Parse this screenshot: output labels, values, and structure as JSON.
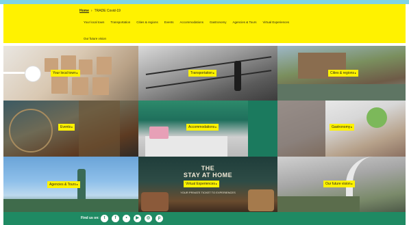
{
  "breadcrumb": {
    "home": "Home",
    "separator": "›",
    "current": "TRADE Covid-19"
  },
  "nav": {
    "row1": [
      "Your local town",
      "Transportation",
      "Cities & regions",
      "Events",
      "Accommodations",
      "Gastronomy",
      "Agencies & Tours",
      "Virtual Experiences"
    ],
    "row2": [
      "Our future vision"
    ]
  },
  "tiles": [
    {
      "label": "Your local town",
      "arrow": "▸"
    },
    {
      "label": "Transportation",
      "arrow": "▸"
    },
    {
      "label": "Cities & regions",
      "arrow": "▸"
    },
    {
      "label": "Events",
      "arrow": "▸"
    },
    {
      "label": "Accommodations",
      "arrow": "▸"
    },
    {
      "label": "Gastronomy",
      "arrow": "▸"
    },
    {
      "label": "Agencies & Tours",
      "arrow": "▸"
    },
    {
      "label": "Virtual Experiences",
      "arrow": "▸"
    },
    {
      "label": "Our future vision",
      "arrow": "▸"
    }
  ],
  "virtual_banner": {
    "line1": "THE",
    "line2": "STAY AT HOME",
    "sub": "YOUR PRIVATE TICKET TO EXPERIENCES"
  },
  "footer": {
    "find_us": "Find us on:",
    "social_icons": [
      "twitter-icon",
      "facebook-icon",
      "flickr-icon",
      "youtube-icon",
      "instagram-icon",
      "pinterest-icon"
    ],
    "social_glyphs": [
      "t",
      "f",
      "•",
      "▶",
      "◎",
      "p"
    ]
  },
  "colors": {
    "accent_yellow": "#fff200",
    "footer_green": "#1f8a63",
    "top_strip": "#7fd3e6"
  }
}
